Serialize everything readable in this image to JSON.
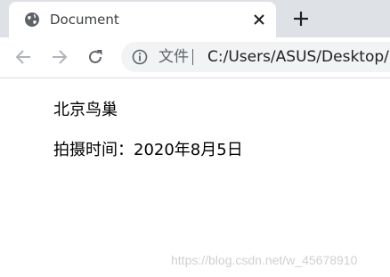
{
  "tab": {
    "title": "Document",
    "favicon": "globe-icon",
    "close_icon": "close-icon"
  },
  "new_tab_icon": "plus-icon",
  "toolbar": {
    "back_icon": "arrow-left-icon",
    "forward_icon": "arrow-right-icon",
    "reload_icon": "reload-icon"
  },
  "omnibox": {
    "info_icon": "info-icon",
    "security_label": "文件",
    "url": "C:/Users/ASUS/Desktop/"
  },
  "page": {
    "heading": "北京鸟巢",
    "capture_time": "拍摄时间：2020年8月5日"
  },
  "watermark": "https://blog.csdn.net/w_45678910",
  "colors": {
    "tabstrip_bg": "#dee1e6",
    "omnibox_bg": "#f1f3f4",
    "icon_gray": "#5f6368"
  }
}
